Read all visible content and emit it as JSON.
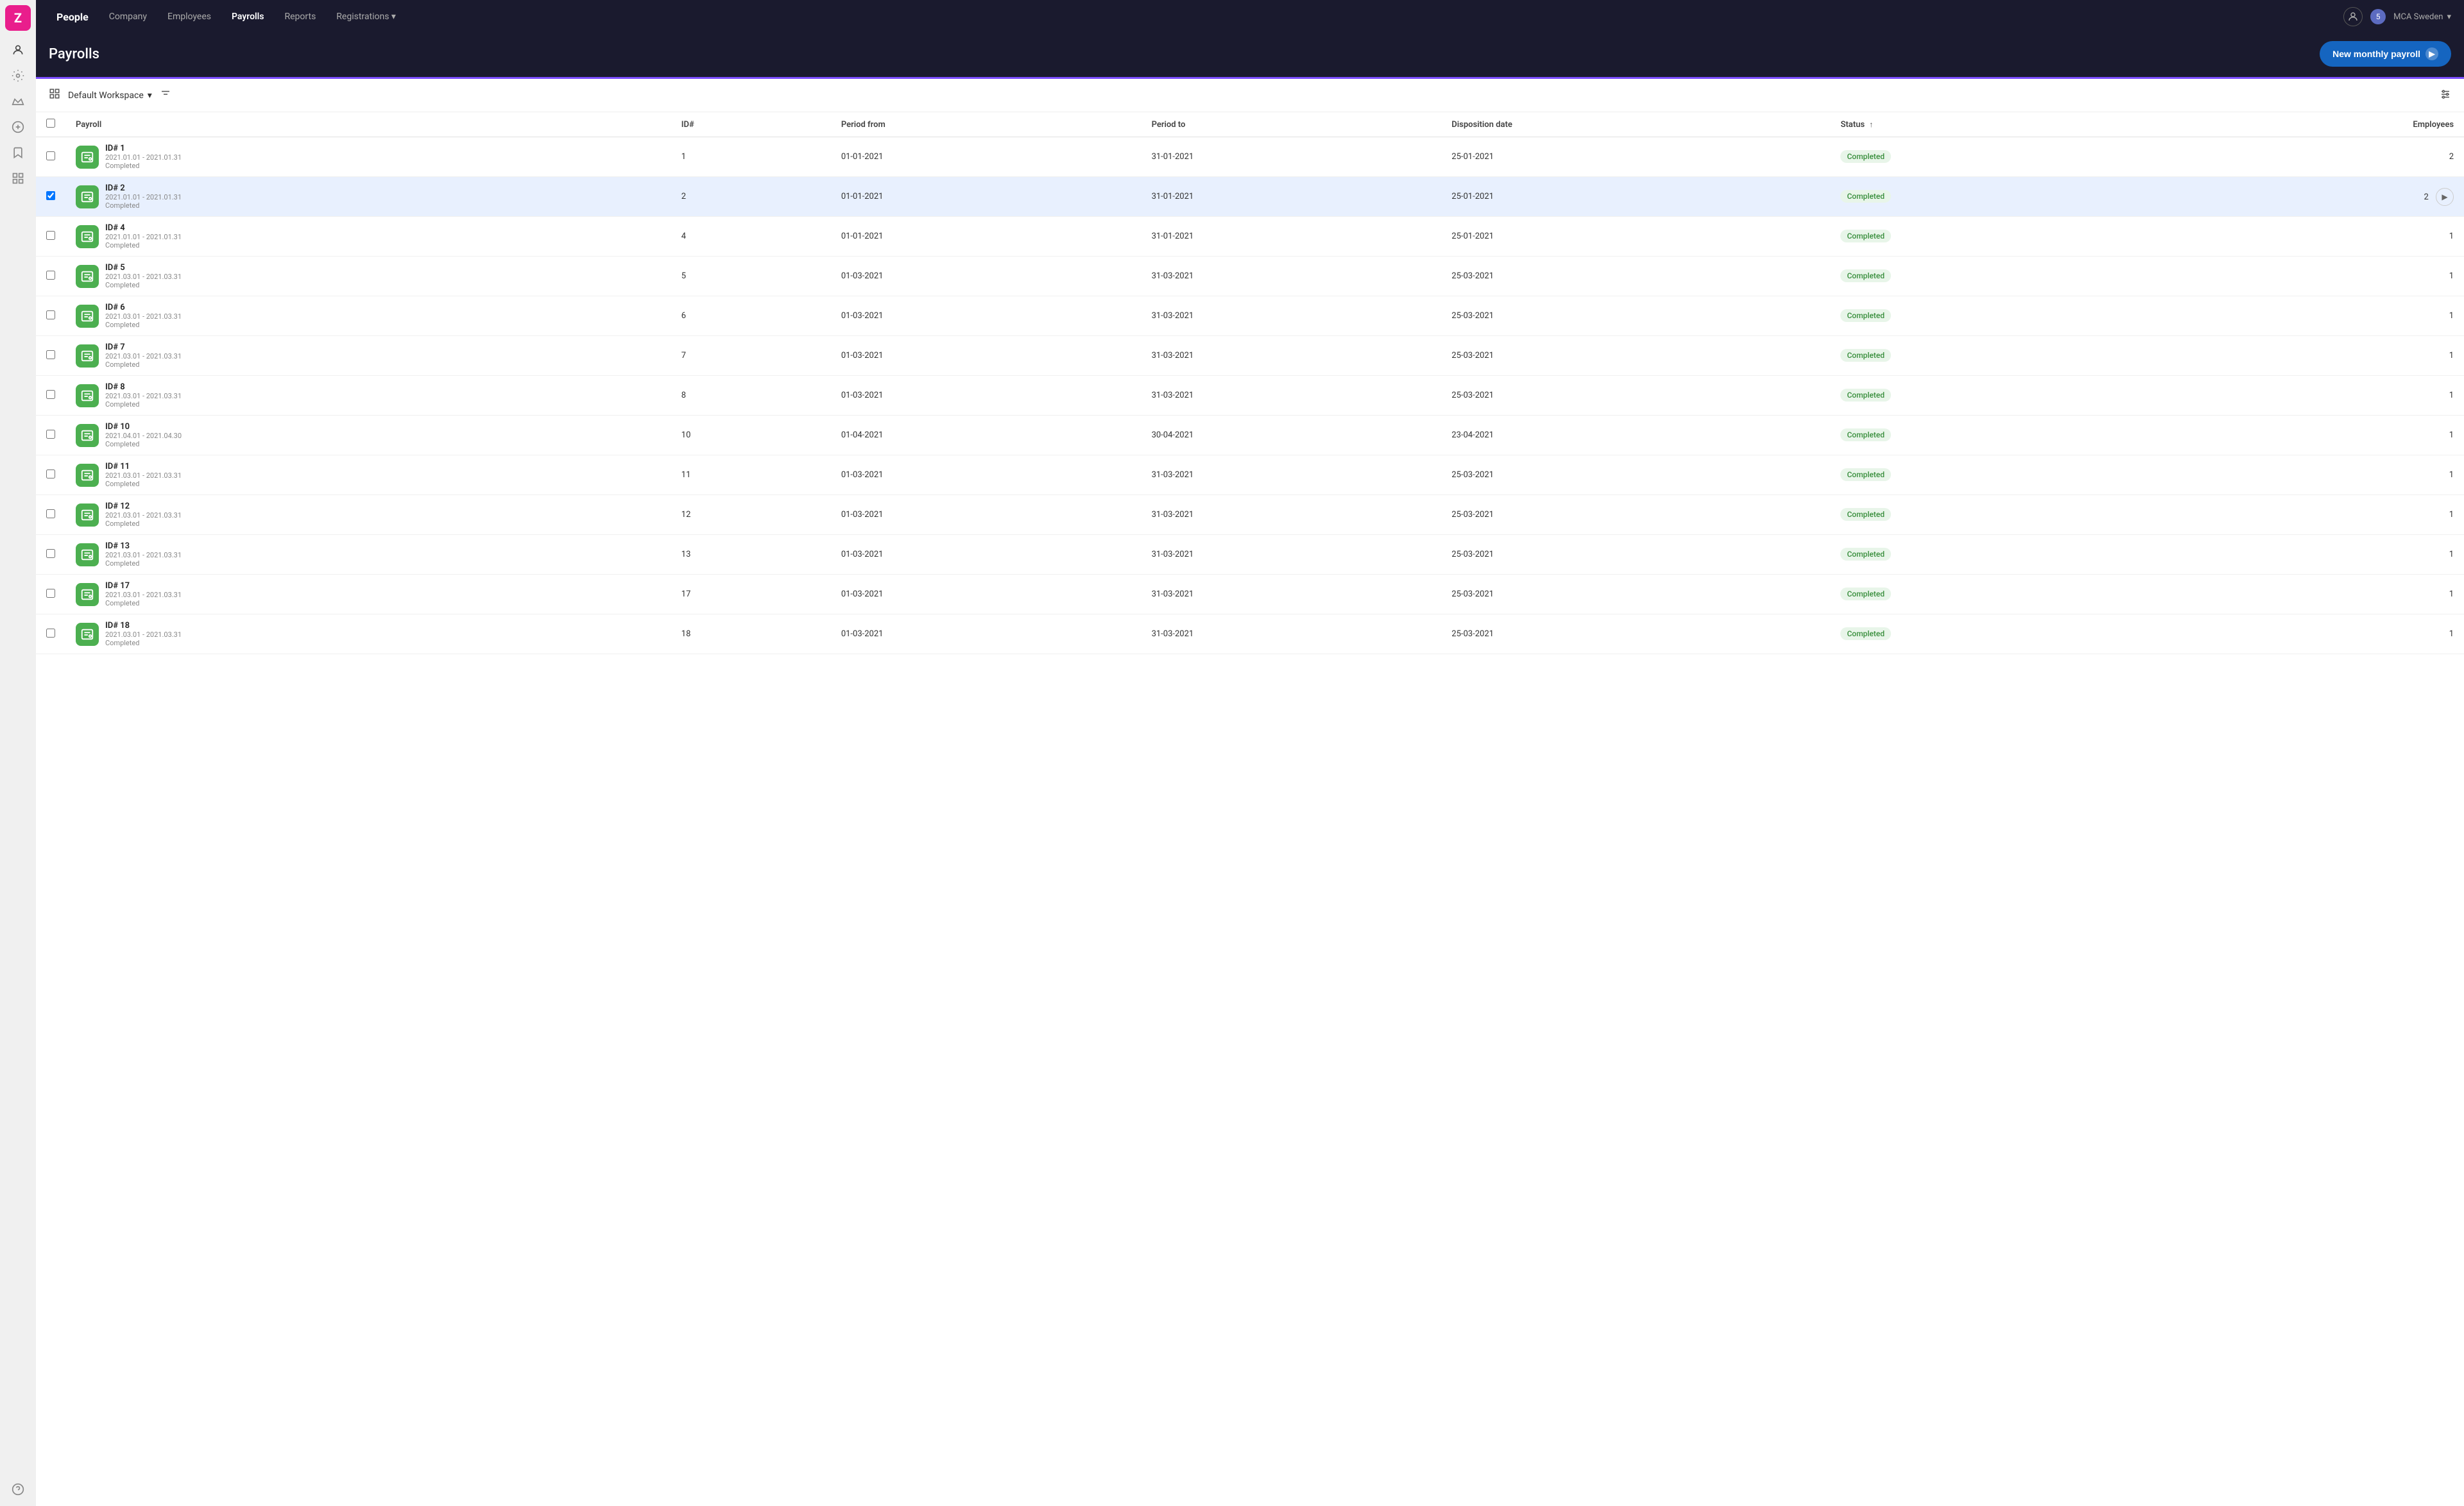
{
  "brand": {
    "logo_letter": "Z"
  },
  "topnav": {
    "items": [
      {
        "label": "People",
        "active": true,
        "people": true
      },
      {
        "label": "Company",
        "active": false
      },
      {
        "label": "Employees",
        "active": false
      },
      {
        "label": "Payrolls",
        "active": true
      },
      {
        "label": "Reports",
        "active": false
      },
      {
        "label": "Registrations",
        "active": false,
        "dropdown": true
      }
    ],
    "user_icon": "👤",
    "notification_count": "5",
    "company": "MCA Sweden"
  },
  "header": {
    "title": "Payrolls",
    "new_button_label": "New monthly payroll"
  },
  "workspace": {
    "name": "Default Workspace"
  },
  "table": {
    "columns": [
      {
        "label": "Payroll",
        "key": "payroll"
      },
      {
        "label": "ID#",
        "key": "id"
      },
      {
        "label": "Period from",
        "key": "period_from"
      },
      {
        "label": "Period to",
        "key": "period_to"
      },
      {
        "label": "Disposition date",
        "key": "disposition_date"
      },
      {
        "label": "Status",
        "key": "status",
        "sortable": true
      },
      {
        "label": "Employees",
        "key": "employees",
        "right": true
      }
    ],
    "rows": [
      {
        "id_label": "ID# 1",
        "date_range": "2021.01.01 - 2021.01.31",
        "status_text": "Completed",
        "id_num": "1",
        "period_from": "01-01-2021",
        "period_to": "31-01-2021",
        "disposition": "25-01-2021",
        "status": "Completed",
        "employees": "2",
        "selected": false
      },
      {
        "id_label": "ID# 2",
        "date_range": "2021.01.01 - 2021.01.31",
        "status_text": "Completed",
        "id_num": "2",
        "period_from": "01-01-2021",
        "period_to": "31-01-2021",
        "disposition": "25-01-2021",
        "status": "Completed",
        "employees": "2",
        "selected": true
      },
      {
        "id_label": "ID# 4",
        "date_range": "2021.01.01 - 2021.01.31",
        "status_text": "Completed",
        "id_num": "4",
        "period_from": "01-01-2021",
        "period_to": "31-01-2021",
        "disposition": "25-01-2021",
        "status": "Completed",
        "employees": "1",
        "selected": false
      },
      {
        "id_label": "ID# 5",
        "date_range": "2021.03.01 - 2021.03.31",
        "status_text": "Completed",
        "id_num": "5",
        "period_from": "01-03-2021",
        "period_to": "31-03-2021",
        "disposition": "25-03-2021",
        "status": "Completed",
        "employees": "1",
        "selected": false
      },
      {
        "id_label": "ID# 6",
        "date_range": "2021.03.01 - 2021.03.31",
        "status_text": "Completed",
        "id_num": "6",
        "period_from": "01-03-2021",
        "period_to": "31-03-2021",
        "disposition": "25-03-2021",
        "status": "Completed",
        "employees": "1",
        "selected": false
      },
      {
        "id_label": "ID# 7",
        "date_range": "2021.03.01 - 2021.03.31",
        "status_text": "Completed",
        "id_num": "7",
        "period_from": "01-03-2021",
        "period_to": "31-03-2021",
        "disposition": "25-03-2021",
        "status": "Completed",
        "employees": "1",
        "selected": false
      },
      {
        "id_label": "ID# 8",
        "date_range": "2021.03.01 - 2021.03.31",
        "status_text": "Completed",
        "id_num": "8",
        "period_from": "01-03-2021",
        "period_to": "31-03-2021",
        "disposition": "25-03-2021",
        "status": "Completed",
        "employees": "1",
        "selected": false
      },
      {
        "id_label": "ID# 10",
        "date_range": "2021.04.01 - 2021.04.30",
        "status_text": "Completed",
        "id_num": "10",
        "period_from": "01-04-2021",
        "period_to": "30-04-2021",
        "disposition": "23-04-2021",
        "status": "Completed",
        "employees": "1",
        "selected": false
      },
      {
        "id_label": "ID# 11",
        "date_range": "2021.03.01 - 2021.03.31",
        "status_text": "Completed",
        "id_num": "11",
        "period_from": "01-03-2021",
        "period_to": "31-03-2021",
        "disposition": "25-03-2021",
        "status": "Completed",
        "employees": "1",
        "selected": false
      },
      {
        "id_label": "ID# 12",
        "date_range": "2021.03.01 - 2021.03.31",
        "status_text": "Completed",
        "id_num": "12",
        "period_from": "01-03-2021",
        "period_to": "31-03-2021",
        "disposition": "25-03-2021",
        "status": "Completed",
        "employees": "1",
        "selected": false
      },
      {
        "id_label": "ID# 13",
        "date_range": "2021.03.01 - 2021.03.31",
        "status_text": "Completed",
        "id_num": "13",
        "period_from": "01-03-2021",
        "period_to": "31-03-2021",
        "disposition": "25-03-2021",
        "status": "Completed",
        "employees": "1",
        "selected": false
      },
      {
        "id_label": "ID# 17",
        "date_range": "2021.03.01 - 2021.03.31",
        "status_text": "Completed",
        "id_num": "17",
        "period_from": "01-03-2021",
        "period_to": "31-03-2021",
        "disposition": "25-03-2021",
        "status": "Completed",
        "employees": "1",
        "selected": false
      },
      {
        "id_label": "ID# 18",
        "date_range": "2021.03.01 - 2021.03.31",
        "status_text": "Completed",
        "id_num": "18",
        "period_from": "01-03-2021",
        "period_to": "31-03-2021",
        "disposition": "25-03-2021",
        "status": "Completed",
        "employees": "1",
        "selected": false
      }
    ]
  },
  "sidebar_icons": {
    "user": "👤",
    "settings": "⚙️",
    "crown": "👑",
    "plus": "➕",
    "bookmark": "🔖",
    "table": "⊞",
    "help": "❓"
  }
}
